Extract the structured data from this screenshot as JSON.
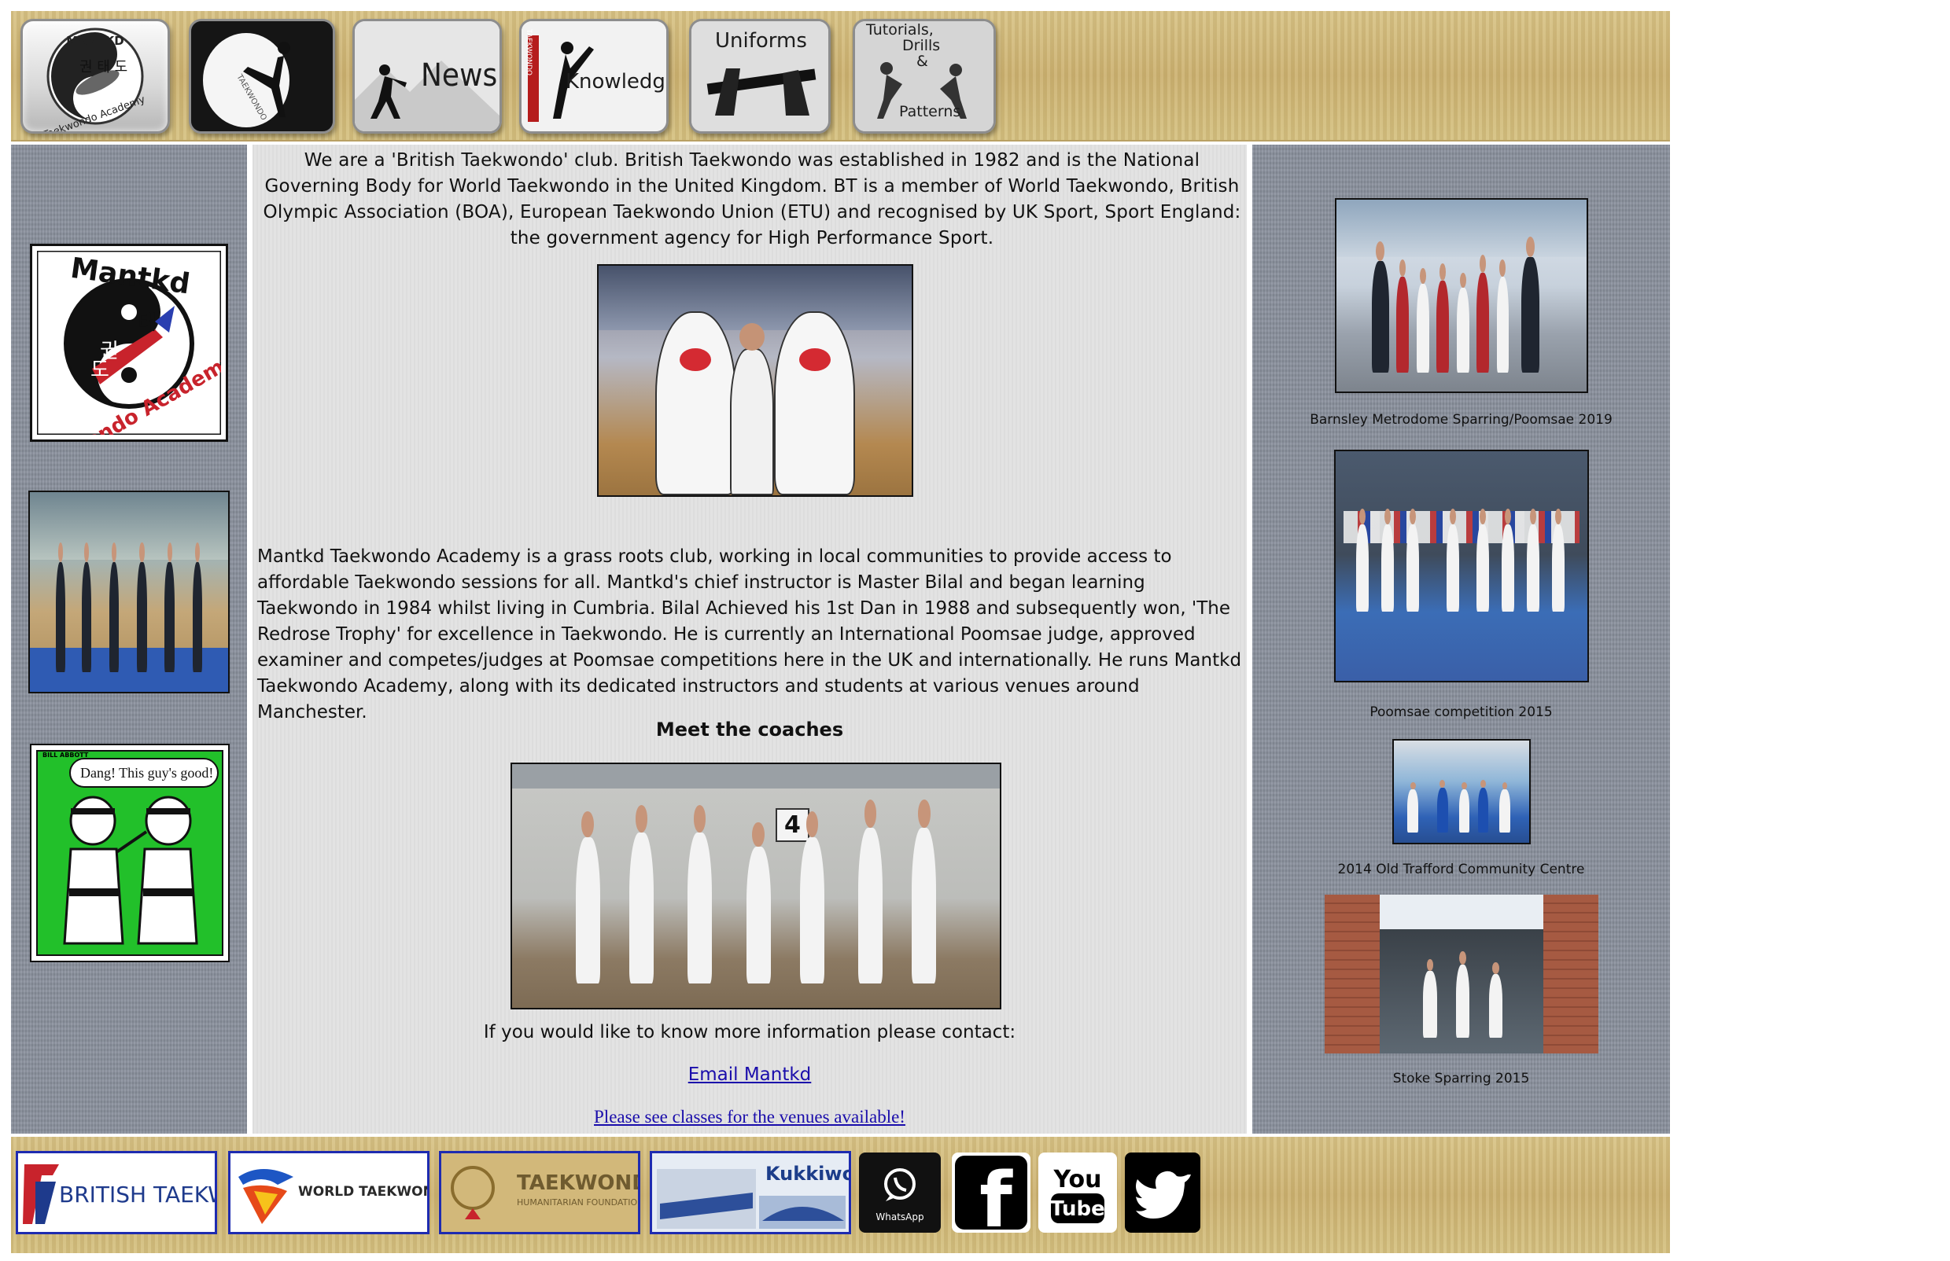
{
  "nav": {
    "logo_top": "MANTKD",
    "logo_bottom": "Taekwondo Academy",
    "logo_korean": "권 태 도",
    "taekwondo_label": "TAEKWONDO",
    "news_label": "News",
    "knowledge_label": "Knowledge",
    "knowledge_side": "TAEKWONDO",
    "uniforms_label": "Uniforms",
    "tutorials_line1": "Tutorials,",
    "tutorials_line2": "Drills",
    "tutorials_line3": "&",
    "tutorials_line4": "Patterns"
  },
  "left": {
    "logo_top": "Mantkd",
    "logo_korean_1": "태",
    "logo_korean_2": "권",
    "logo_korean_3": "도",
    "logo_bottom": "Taekwondo Academy",
    "cartoon_signature": "BILL ABBOTT",
    "cartoon_speech": "Dang! This guy's good!"
  },
  "main": {
    "intro": "We are a 'British Taekwondo' club. British Taekwondo was established in 1982 and is the National Governing Body for World Taekwondo in the United Kingdom. BT is a member of World Taekwondo, British Olympic Association (BOA), European Taekwondo Union (ETU) and recognised by UK Sport, Sport England: the government agency for High Performance Sport.",
    "about": "Mantkd Taekwondo Academy is a grass roots club, working in local communities to provide access to affordable Taekwondo sessions for all. Mantkd's chief instructor is Master Bilal and began learning Taekwondo in 1984 whilst living in Cumbria. Bilal Achieved his 1st Dan in 1988 and subsequently won, 'The Redrose Trophy' for excellence in Taekwondo. He is currently an International Poomsae judge, approved examiner and competes/judges at Poomsae competitions here in the UK and internationally. He runs Mantkd Taekwondo Academy, along with its dedicated instructors and students at various venues around Manchester.",
    "meet_heading": "Meet the coaches",
    "court_sign": "4",
    "contact_text": "If you would like to know more information please contact:",
    "email_link": "Email Mantkd",
    "venues_link": "Please see classes for the venues available!"
  },
  "right": {
    "captions": [
      "Barnsley Metrodome Sparring/Poomsae 2019",
      "Poomsae competition 2015",
      "2014 Old Trafford Community Centre",
      "Stoke Sparring 2015"
    ]
  },
  "footer": {
    "british_taekwondo": "BRITISH TAEKWONDO",
    "world_taekwondo": "WORLD TAEKWONDO",
    "humanitarian_1": "TAEKWONDO",
    "humanitarian_2": "HUMANITARIAN FOUNDATION",
    "kukkiwon": "Kukkiwon",
    "whatsapp": "WhatsApp",
    "facebook": "f",
    "youtube_1": "You",
    "youtube_2": "Tube"
  },
  "colors": {
    "link": "#1a0dab",
    "banner": "#d4bd7f",
    "side": "#8a919d",
    "center": "#e2e2e2",
    "logo_border": "#1e2bb0"
  }
}
